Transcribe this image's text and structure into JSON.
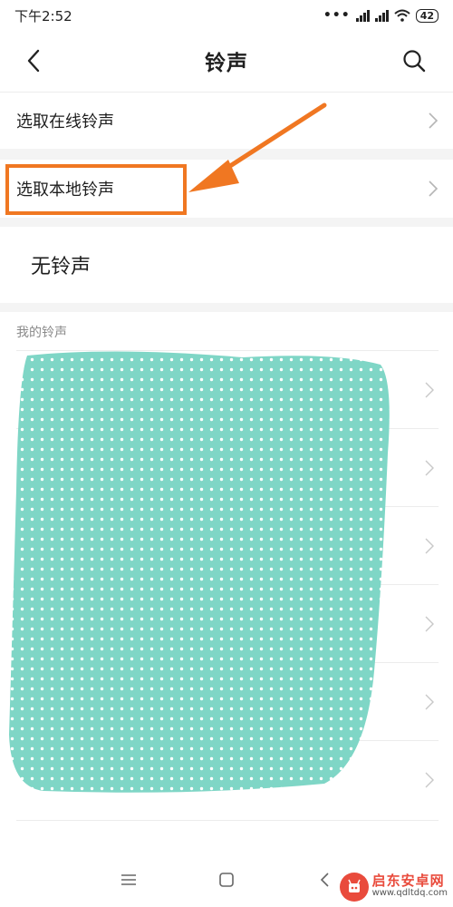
{
  "status_bar": {
    "time": "下午2:52",
    "battery": "42",
    "icons": [
      "more-dots-icon",
      "signal-icon",
      "signal-icon",
      "wifi-icon",
      "battery-icon"
    ]
  },
  "header": {
    "title": "铃声",
    "back_icon": "chevron-left-icon",
    "search_icon": "search-icon"
  },
  "menu": {
    "online": "选取在线铃声",
    "local": "选取本地铃声",
    "none": "无铃声"
  },
  "section": {
    "label": "我的铃声",
    "hidden_items_count": 6
  },
  "annotation": {
    "highlight_color": "#f07722",
    "blob_color": "#7fd6c6"
  },
  "nav": {
    "icons": [
      "menu-icon",
      "home-square-icon",
      "back-chevron-icon"
    ]
  },
  "watermark": {
    "name": "启东安卓网",
    "url": "www.qdltdq.com",
    "color": "#e94b3c"
  }
}
